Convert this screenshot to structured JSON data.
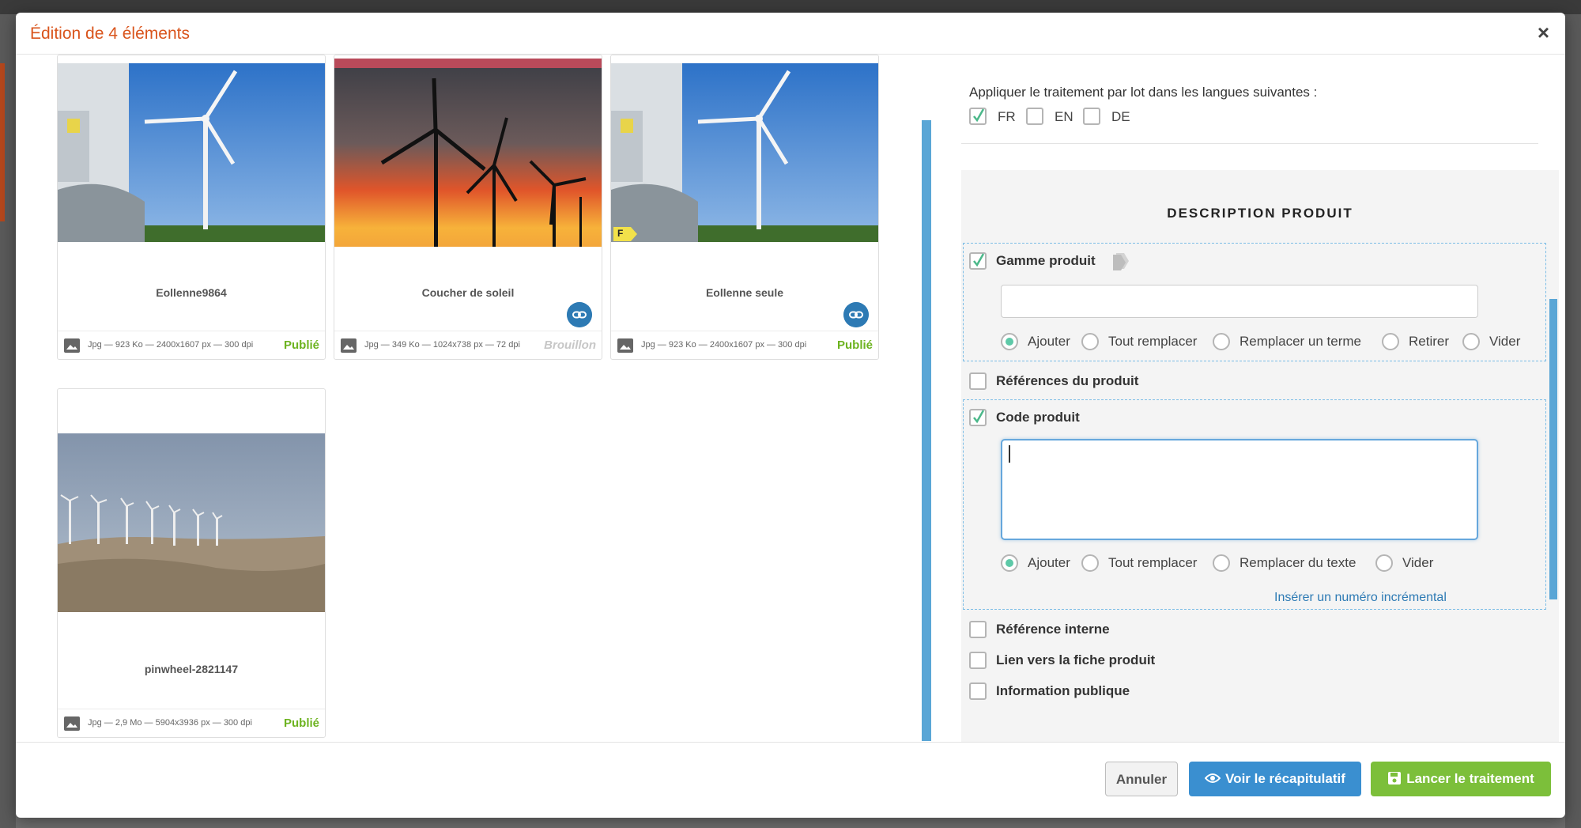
{
  "modal": {
    "title": "Édition de 4 éléments",
    "close_glyph": "×"
  },
  "gallery": {
    "items": [
      {
        "name": "Eollenne9864",
        "meta": "Jpg — 923 Ko — 2400x1607 px — 300 dpi",
        "status": "Publié",
        "has_link": false,
        "has_flag": false
      },
      {
        "name": "Coucher de soleil",
        "meta": "Jpg — 349 Ko — 1024x738 px — 72 dpi",
        "status": "Brouillon",
        "has_link": true,
        "has_flag": false
      },
      {
        "name": "Eollenne seule",
        "meta": "Jpg — 923 Ko — 2400x1607 px — 300 dpi",
        "status": "Publié",
        "has_link": true,
        "has_flag": true
      },
      {
        "name": "pinwheel-2821147",
        "meta": "Jpg — 2,9 Mo — 5904x3936 px — 300 dpi",
        "status": "Publié",
        "has_link": false,
        "has_flag": false
      }
    ],
    "flag_letter": "F"
  },
  "languages": {
    "label": "Appliquer le traitement par lot dans les langues suivantes :",
    "options": [
      {
        "code": "FR",
        "checked": true
      },
      {
        "code": "EN",
        "checked": false
      },
      {
        "code": "DE",
        "checked": false
      }
    ]
  },
  "description": {
    "title": "DESCRIPTION PRODUIT",
    "fields": {
      "gamme": {
        "label": "Gamme produit",
        "checked": true,
        "value": "",
        "modes": [
          "Ajouter",
          "Tout remplacer",
          "Remplacer un terme",
          "Retirer",
          "Vider"
        ],
        "selected": "Ajouter"
      },
      "references": {
        "label": "Références du produit",
        "checked": false
      },
      "code": {
        "label": "Code produit",
        "checked": true,
        "value": "",
        "modes": [
          "Ajouter",
          "Tout remplacer",
          "Remplacer du texte",
          "Vider"
        ],
        "selected": "Ajouter",
        "link": "Insérer un numéro incrémental"
      },
      "reference_interne": {
        "label": "Référence interne",
        "checked": false
      },
      "lien_fiche": {
        "label": "Lien vers la fiche produit",
        "checked": false
      },
      "information_publique": {
        "label": "Information publique",
        "checked": false
      }
    }
  },
  "footer": {
    "cancel": "Annuler",
    "summary": "Voir le récapitulatif",
    "run": "Lancer le traitement"
  },
  "colors": {
    "title": "#d9541c",
    "published": "#6db320",
    "draft": "#c7c7c7",
    "primary": "#3a8fd0",
    "success": "#7cbf3a",
    "radio_on": "#5ec9a8"
  }
}
